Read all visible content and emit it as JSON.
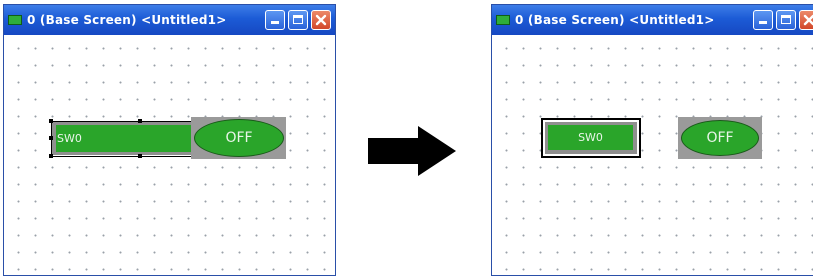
{
  "left_window": {
    "title": "0 (Base Screen) <Untitled1>",
    "switch_label": "SW0",
    "lamp_label": "OFF"
  },
  "right_window": {
    "title": "0 (Base Screen) <Untitled1>",
    "switch_label": "SW0",
    "lamp_label": "OFF"
  },
  "icons": {
    "title_icon": "screen-icon",
    "minimize": "minimize-icon",
    "maximize": "maximize-icon",
    "close": "close-icon",
    "arrow": "right-arrow-icon"
  },
  "colors": {
    "titlebar": "#1c5bd6",
    "object_green": "#2aa52a",
    "object_frame": "#8f8f8f",
    "close_button": "#d2472a"
  }
}
